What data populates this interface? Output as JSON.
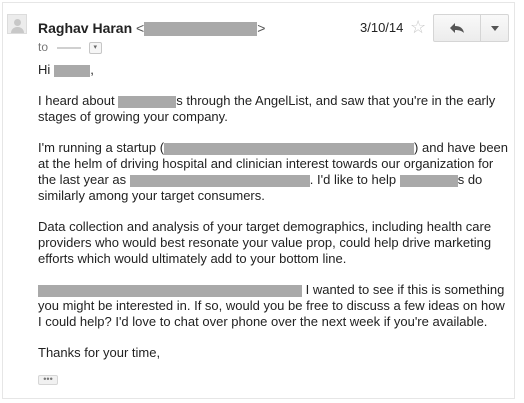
{
  "header": {
    "sender_name": "Raghav Haran",
    "lt": "<",
    "gt": ">",
    "to_prefix": "to",
    "date": "3/10/14"
  },
  "icons": {
    "avatar": "avatar-icon",
    "star": "star-icon",
    "reply": "reply-icon",
    "more": "chevron-down-icon",
    "to_dropdown": "chevron-down-icon",
    "show_trimmed": "ellipsis-icon"
  },
  "colors": {
    "redaction": "#a9a9a9",
    "star": "#c8c8c8"
  },
  "message": {
    "greeting_prefix": "Hi",
    "greeting_suffix": ",",
    "p1_a": "I heard about",
    "p1_b": "s through the AngelList, and saw that you're in the early stages of growing your company.",
    "p2_a": "I'm running a startup (",
    "p2_b": ") and have been at the helm of driving hospital and clinician interest towards our organization for the last year as",
    "p2_c": ". I'd like to help",
    "p2_d": "s do similarly among your target consumers.",
    "p3": "Data collection and analysis of your target demographics, including health care providers who would best resonate your value prop, could help drive marketing efforts which would ultimately add to your bottom line.",
    "p4_b": " I wanted to see if this is something you might be interested in. If so, would you be free to discuss a few ideas on how I could help? I'd love to chat over phone over the next week if you're available.",
    "closing": "Thanks for your time,"
  }
}
